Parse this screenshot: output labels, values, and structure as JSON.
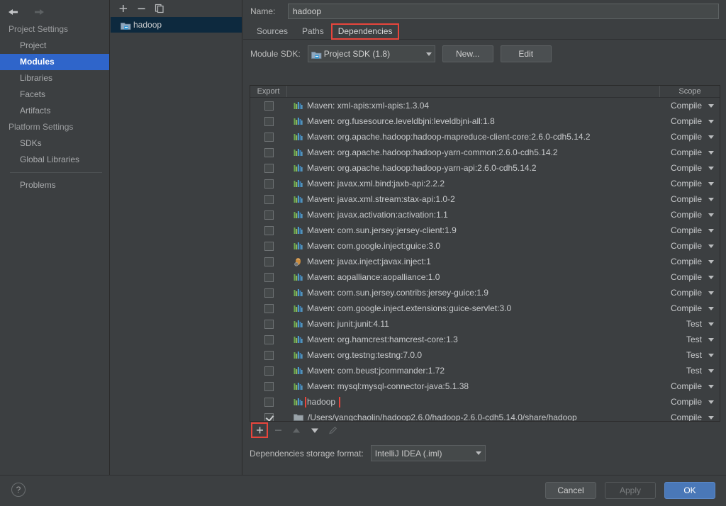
{
  "window": {
    "accent_selection": "#2f65ca",
    "highlight_box": "#e8453c",
    "ok_button_color": "#4a78b8"
  },
  "nav": {
    "back_icon": "arrow-left-icon",
    "forward_icon": "arrow-right-icon"
  },
  "sidebar": {
    "groups": [
      {
        "label": "Project Settings",
        "items": [
          {
            "label": "Project",
            "selected": false
          },
          {
            "label": "Modules",
            "selected": true
          },
          {
            "label": "Libraries",
            "selected": false
          },
          {
            "label": "Facets",
            "selected": false
          },
          {
            "label": "Artifacts",
            "selected": false
          }
        ]
      },
      {
        "label": "Platform Settings",
        "items": [
          {
            "label": "SDKs",
            "selected": false
          },
          {
            "label": "Global Libraries",
            "selected": false
          }
        ]
      }
    ],
    "problems": {
      "label": "Problems"
    },
    "help_icon": "question-mark-icon"
  },
  "module_panel": {
    "toolbar": [
      {
        "icon": "plus-icon",
        "label": "+"
      },
      {
        "icon": "minus-icon",
        "label": "−"
      },
      {
        "icon": "copy-icon",
        "label": "copy"
      }
    ],
    "modules": [
      {
        "label": "hadoop",
        "icon": "module-icon",
        "selected": true
      }
    ]
  },
  "detail": {
    "name_label": "Name:",
    "name_value": "hadoop",
    "tabs": [
      {
        "label": "Sources",
        "selected": false,
        "highlighted": false
      },
      {
        "label": "Paths",
        "selected": false,
        "highlighted": false
      },
      {
        "label": "Dependencies",
        "selected": true,
        "highlighted": true
      }
    ],
    "sdk_label": "Module SDK:",
    "sdk_value": "Project SDK (1.8)",
    "sdk_icon": "sdk-icon",
    "new_button": "New...",
    "edit_button": "Edit",
    "storage_label": "Dependencies storage format:",
    "storage_value": "IntelliJ IDEA (.iml)"
  },
  "dependencies_table": {
    "columns": [
      "Export",
      "",
      "Scope"
    ],
    "rows": [
      {
        "export": false,
        "icon": "maven-icon",
        "label": "Maven: xml-apis:xml-apis:1.3.04",
        "scope": "Compile",
        "boxed": false
      },
      {
        "export": false,
        "icon": "maven-icon",
        "label": "Maven: org.fusesource.leveldbjni:leveldbjni-all:1.8",
        "scope": "Compile",
        "boxed": false
      },
      {
        "export": false,
        "icon": "maven-icon",
        "label": "Maven: org.apache.hadoop:hadoop-mapreduce-client-core:2.6.0-cdh5.14.2",
        "scope": "Compile",
        "boxed": false
      },
      {
        "export": false,
        "icon": "maven-icon",
        "label": "Maven: org.apache.hadoop:hadoop-yarn-common:2.6.0-cdh5.14.2",
        "scope": "Compile",
        "boxed": false
      },
      {
        "export": false,
        "icon": "maven-icon",
        "label": "Maven: org.apache.hadoop:hadoop-yarn-api:2.6.0-cdh5.14.2",
        "scope": "Compile",
        "boxed": false
      },
      {
        "export": false,
        "icon": "maven-icon",
        "label": "Maven: javax.xml.bind:jaxb-api:2.2.2",
        "scope": "Compile",
        "boxed": false
      },
      {
        "export": false,
        "icon": "maven-icon",
        "label": "Maven: javax.xml.stream:stax-api:1.0-2",
        "scope": "Compile",
        "boxed": false
      },
      {
        "export": false,
        "icon": "maven-icon",
        "label": "Maven: javax.activation:activation:1.1",
        "scope": "Compile",
        "boxed": false
      },
      {
        "export": false,
        "icon": "maven-icon",
        "label": "Maven: com.sun.jersey:jersey-client:1.9",
        "scope": "Compile",
        "boxed": false
      },
      {
        "export": false,
        "icon": "maven-icon",
        "label": "Maven: com.google.inject:guice:3.0",
        "scope": "Compile",
        "boxed": false
      },
      {
        "export": false,
        "icon": "jar-icon",
        "label": "Maven: javax.inject:javax.inject:1",
        "scope": "Compile",
        "boxed": false
      },
      {
        "export": false,
        "icon": "maven-icon",
        "label": "Maven: aopalliance:aopalliance:1.0",
        "scope": "Compile",
        "boxed": false
      },
      {
        "export": false,
        "icon": "maven-icon",
        "label": "Maven: com.sun.jersey.contribs:jersey-guice:1.9",
        "scope": "Compile",
        "boxed": false
      },
      {
        "export": false,
        "icon": "maven-icon",
        "label": "Maven: com.google.inject.extensions:guice-servlet:3.0",
        "scope": "Compile",
        "boxed": false
      },
      {
        "export": false,
        "icon": "maven-icon",
        "label": "Maven: junit:junit:4.11",
        "scope": "Test",
        "boxed": false
      },
      {
        "export": false,
        "icon": "maven-icon",
        "label": "Maven: org.hamcrest:hamcrest-core:1.3",
        "scope": "Test",
        "boxed": false
      },
      {
        "export": false,
        "icon": "maven-icon",
        "label": "Maven: org.testng:testng:7.0.0",
        "scope": "Test",
        "boxed": false
      },
      {
        "export": false,
        "icon": "maven-icon",
        "label": "Maven: com.beust:jcommander:1.72",
        "scope": "Test",
        "boxed": false
      },
      {
        "export": false,
        "icon": "maven-icon",
        "label": "Maven: mysql:mysql-connector-java:5.1.38",
        "scope": "Compile",
        "boxed": false
      },
      {
        "export": false,
        "icon": "maven-icon",
        "label": "hadoop",
        "scope": "Compile",
        "boxed": true
      },
      {
        "export": true,
        "icon": "folder-icon",
        "label": "/Users/yangchaolin/hadoop2.6.0/hadoop-2.6.0-cdh5.14.0/share/hadoop",
        "scope": "Compile",
        "boxed": false
      }
    ],
    "toolbar": [
      {
        "icon": "plus-icon",
        "enabled": true,
        "boxed": true
      },
      {
        "icon": "minus-icon",
        "enabled": false,
        "boxed": false
      },
      {
        "icon": "arrow-up-icon",
        "enabled": false,
        "boxed": false
      },
      {
        "icon": "arrow-down-icon",
        "enabled": true,
        "boxed": false
      },
      {
        "icon": "pencil-icon",
        "enabled": false,
        "boxed": false
      }
    ]
  },
  "footer": {
    "cancel": "Cancel",
    "apply": "Apply",
    "ok": "OK"
  }
}
